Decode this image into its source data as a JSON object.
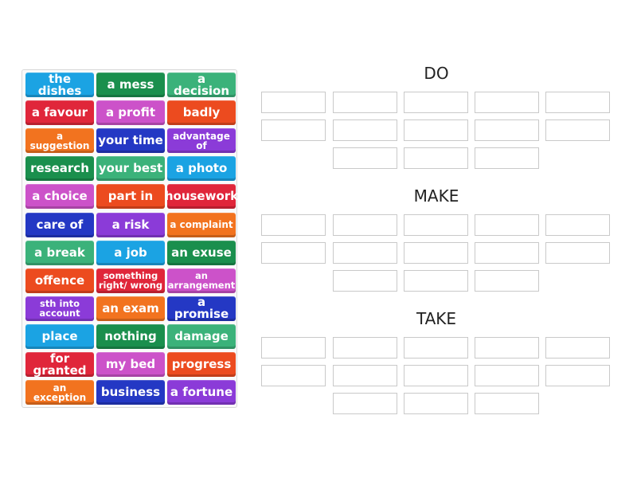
{
  "palette": {
    "rows": [
      [
        {
          "text": "the dishes",
          "color": "#1ba3e3"
        },
        {
          "text": "a mess",
          "color": "#1a8f4d"
        },
        {
          "text": "a decision",
          "color": "#3bb27a"
        }
      ],
      [
        {
          "text": "a favour",
          "color": "#e0263a"
        },
        {
          "text": "a profit",
          "color": "#cc52c9"
        },
        {
          "text": "badly",
          "color": "#ec4b1f"
        }
      ],
      [
        {
          "text": "a suggestion",
          "color": "#f2731f",
          "size": "small"
        },
        {
          "text": "your time",
          "color": "#2438c4"
        },
        {
          "text": "advantage of",
          "color": "#8b3bd8",
          "size": "small"
        }
      ],
      [
        {
          "text": "research",
          "color": "#1a8f4d"
        },
        {
          "text": "your best",
          "color": "#3bb27a"
        },
        {
          "text": "a photo",
          "color": "#1ba3e3"
        }
      ],
      [
        {
          "text": "a choice",
          "color": "#cc52c9"
        },
        {
          "text": "part in",
          "color": "#ec4b1f"
        },
        {
          "text": "housework",
          "color": "#e0263a"
        }
      ],
      [
        {
          "text": "care of",
          "color": "#2438c4"
        },
        {
          "text": "a risk",
          "color": "#8b3bd8"
        },
        {
          "text": "a complaint",
          "color": "#f2731f",
          "size": "small"
        }
      ],
      [
        {
          "text": "a break",
          "color": "#3bb27a"
        },
        {
          "text": "a job",
          "color": "#1ba3e3"
        },
        {
          "text": "an exuse",
          "color": "#1a8f4d"
        }
      ],
      [
        {
          "text": "offence",
          "color": "#ec4b1f"
        },
        {
          "text": "something right/ wrong",
          "color": "#e0263a",
          "size": "two"
        },
        {
          "text": "an arrangement",
          "color": "#cc52c9",
          "size": "two"
        }
      ],
      [
        {
          "text": "sth into account",
          "color": "#8b3bd8",
          "size": "two"
        },
        {
          "text": "an exam",
          "color": "#f2731f"
        },
        {
          "text": "a promise",
          "color": "#2438c4"
        }
      ],
      [
        {
          "text": "place",
          "color": "#1ba3e3"
        },
        {
          "text": "nothing",
          "color": "#1a8f4d"
        },
        {
          "text": "damage",
          "color": "#3bb27a"
        }
      ],
      [
        {
          "text": "for granted",
          "color": "#e0263a"
        },
        {
          "text": "my bed",
          "color": "#cc52c9"
        },
        {
          "text": "progress",
          "color": "#ec4b1f"
        }
      ],
      [
        {
          "text": "an exception",
          "color": "#f2731f",
          "size": "small"
        },
        {
          "text": "business",
          "color": "#2438c4"
        },
        {
          "text": "a fortune",
          "color": "#8b3bd8"
        }
      ]
    ]
  },
  "groups": [
    {
      "title": "DO"
    },
    {
      "title": "MAKE"
    },
    {
      "title": "TAKE"
    }
  ]
}
